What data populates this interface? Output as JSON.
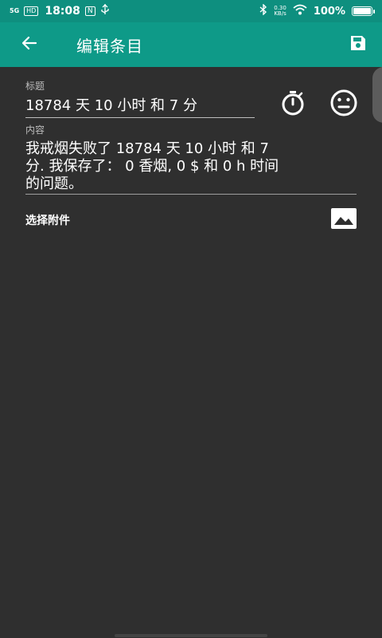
{
  "status_bar": {
    "network": "5G",
    "hd": "HD",
    "time": "18:08",
    "mini_icon": "N",
    "usb_icon": "usb-icon",
    "bluetooth_icon": "bluetooth-icon",
    "speed_value": "0.30",
    "speed_unit": "KB/s",
    "wifi_icon": "wifi-icon",
    "battery_percent": "100%",
    "battery_level": 1.0
  },
  "app_bar": {
    "back_icon": "arrow-left-icon",
    "title": "编辑条目",
    "save_icon": "save-icon",
    "background": "#0e9a88"
  },
  "form": {
    "title_label": "标题",
    "title_value": "18784 天 10 小时 和 7 分",
    "timer_icon": "stopwatch-icon",
    "emoji_icon": "emoji-neutral-icon",
    "content_label": "内容",
    "content_line1": "我戒烟失败了 18784 天 10 小时 和 7",
    "content_line2": "分. 我保存了：  0 香烟, 0 $ 和 0 h 时间",
    "content_line3": "的问题。",
    "attachment_label": "选择附件",
    "image_icon": "image-icon"
  }
}
